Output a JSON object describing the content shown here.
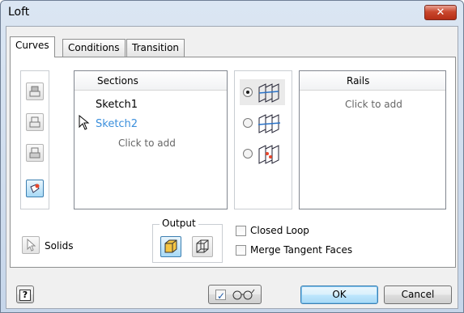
{
  "window": {
    "title": "Loft",
    "close_glyph": "✕"
  },
  "tabs": [
    {
      "label": "Curves",
      "active": true
    },
    {
      "label": "Conditions",
      "active": false
    },
    {
      "label": "Transition",
      "active": false
    }
  ],
  "sections": {
    "header": "Sections",
    "items": [
      "Sketch1",
      "Sketch2"
    ],
    "selected_color": "#3b8fdc",
    "add_hint": "Click to add"
  },
  "rails": {
    "header": "Rails",
    "add_hint": "Click to add"
  },
  "loft_type_options": [
    {
      "icon": "rails-loft-icon",
      "selected": true
    },
    {
      "icon": "center-line-loft-icon",
      "selected": false
    },
    {
      "icon": "area-loft-icon",
      "selected": false
    }
  ],
  "solids": {
    "label": "Solids"
  },
  "output": {
    "label": "Output",
    "options": [
      {
        "icon": "solid-output-icon",
        "selected": true
      },
      {
        "icon": "surface-output-icon",
        "selected": false
      }
    ]
  },
  "options": {
    "closed_loop": {
      "label": "Closed Loop",
      "checked": false
    },
    "merge_tangent_faces": {
      "label": "Merge Tangent Faces",
      "checked": false
    }
  },
  "footer": {
    "help_glyph": "?",
    "preview_checked": true,
    "ok_label": "OK",
    "cancel_label": "Cancel"
  }
}
